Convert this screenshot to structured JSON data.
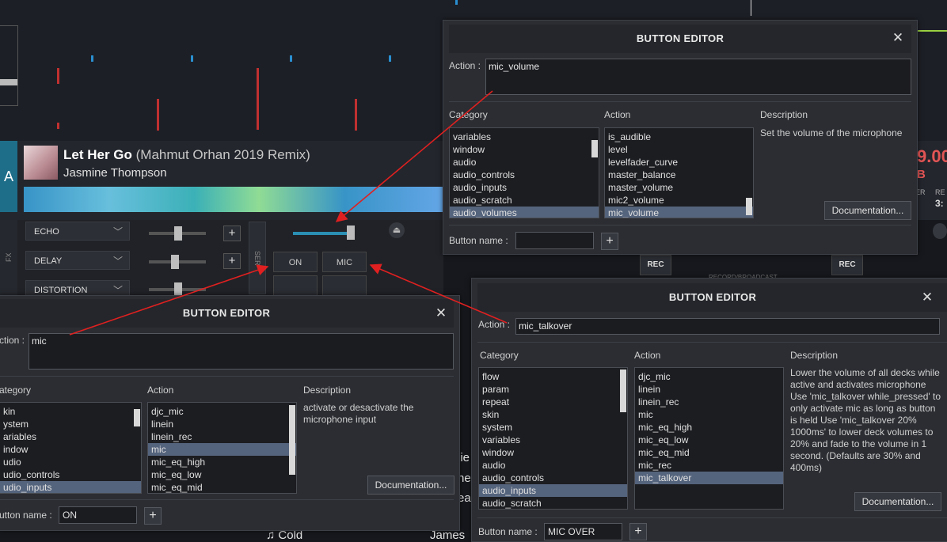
{
  "deck": {
    "letter": "A",
    "title": "Let Her Go",
    "remix": "(Mahmut Orhan 2019 Remix)",
    "artist": "Jasmine Thompson"
  },
  "fx": {
    "label": "FX",
    "effects": [
      "ECHO",
      "DELAY",
      "DISTORTION"
    ],
    "side_label": "SER"
  },
  "mic_pads": {
    "on": "ON",
    "mic_over": "MIC OVER"
  },
  "recorder": {
    "rec1": "REC",
    "rec2": "REC",
    "label": "RECORD/BROADCAST"
  },
  "right_display": {
    "num": "9.00",
    "b": "B",
    "rem": "RE",
    "time": "3:",
    "er": "ER"
  },
  "bottom": {
    "left_words": [
      "lie",
      "he",
      "ea"
    ],
    "cold": "Cold",
    "james": "James"
  },
  "dialogs": {
    "top": {
      "title": "BUTTON EDITOR",
      "action_label": "Action :",
      "action_value": "mic_volume",
      "category_label": "Category",
      "action_col_label": "Action",
      "description_label": "Description",
      "categories": [
        "variables",
        "window",
        "audio",
        "audio_controls",
        "audio_inputs",
        "audio_scratch",
        "audio_volumes"
      ],
      "selected_category": 6,
      "actions": [
        "is_audible",
        "level",
        "levelfader_curve",
        "master_balance",
        "master_volume",
        "mic2_volume",
        "mic_volume"
      ],
      "selected_action": 6,
      "description": "Set the volume of the microphone",
      "documentation": "Documentation...",
      "button_name_label": "Button name :",
      "button_name_value": "",
      "add": "+",
      "close": "✕"
    },
    "left": {
      "title": "BUTTON EDITOR",
      "action_label": "ction :",
      "action_value": "mic",
      "category_label": "ategory",
      "action_col_label": "Action",
      "description_label": "Description",
      "categories": [
        "kin",
        "ystem",
        "ariables",
        "indow",
        "udio",
        "udio_controls",
        "udio_inputs"
      ],
      "selected_category": 6,
      "actions": [
        "djc_mic",
        "linein",
        "linein_rec",
        "mic",
        "mic_eq_high",
        "mic_eq_low",
        "mic_eq_mid"
      ],
      "selected_action": 3,
      "description": "activate or desactivate the microphone input",
      "documentation": "Documentation...",
      "button_name_label": "utton name :",
      "button_name_value": "ON",
      "add": "+",
      "close": "✕"
    },
    "right": {
      "title": "BUTTON EDITOR",
      "action_label": "Action :",
      "action_value": "mic_talkover",
      "category_label": "Category",
      "action_col_label": "Action",
      "description_label": "Description",
      "categories": [
        "flow",
        "param",
        "repeat",
        "skin",
        "system",
        "variables",
        "window",
        "audio",
        "audio_controls",
        "audio_inputs",
        "audio_scratch"
      ],
      "selected_category": 9,
      "actions": [
        "djc_mic",
        "linein",
        "linein_rec",
        "mic",
        "mic_eq_high",
        "mic_eq_low",
        "mic_eq_mid",
        "mic_rec",
        "mic_talkover"
      ],
      "selected_action": 8,
      "description": "Lower the volume of all decks while active and activates microphone Use 'mic_talkover while_pressed' to only activate mic as long as button is held Use 'mic_talkover 20% 1000ms' to lower deck volumes to 20% and fade to the volume in 1 second. (Defaults are 30% and 400ms)",
      "documentation": "Documentation...",
      "button_name_label": "Button name :",
      "button_name_value": "MIC OVER",
      "add": "+",
      "close": "✕"
    }
  },
  "colors": {
    "accent": "#1e6e8a",
    "selection": "#55647d",
    "arrow": "#e02020"
  }
}
